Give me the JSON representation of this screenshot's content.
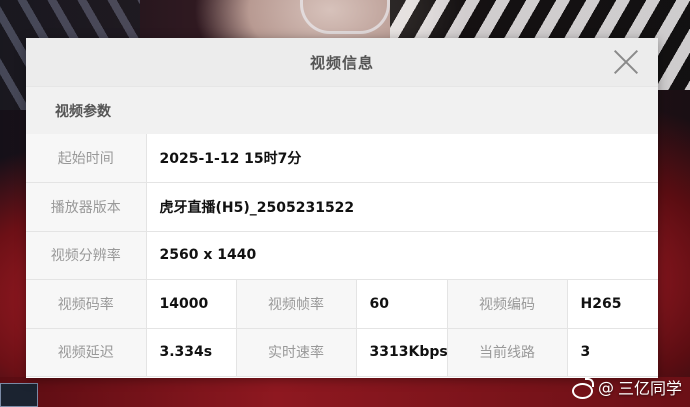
{
  "dialog": {
    "title": "视频信息",
    "section_title": "视频参数",
    "rows": {
      "start_time": {
        "label": "起始时间",
        "value": "2025-1-12 15时7分"
      },
      "player_version": {
        "label": "播放器版本",
        "value": "虎牙直播(H5)_2505231522"
      },
      "resolution": {
        "label": "视频分辨率",
        "value": "2560 x 1440"
      },
      "bitrate": {
        "label": "视频码率",
        "value": "14000"
      },
      "framerate": {
        "label": "视频帧率",
        "value": "60"
      },
      "codec": {
        "label": "视频编码",
        "value": "H265"
      },
      "latency": {
        "label": "视频延迟",
        "value": "3.334s"
      },
      "speed": {
        "label": "实时速率",
        "value": "3313Kbps"
      },
      "line": {
        "label": "当前线路",
        "value": "3"
      }
    }
  },
  "watermark": {
    "prefix": "@",
    "text": "三亿同学",
    "icon": "weibo-icon"
  }
}
